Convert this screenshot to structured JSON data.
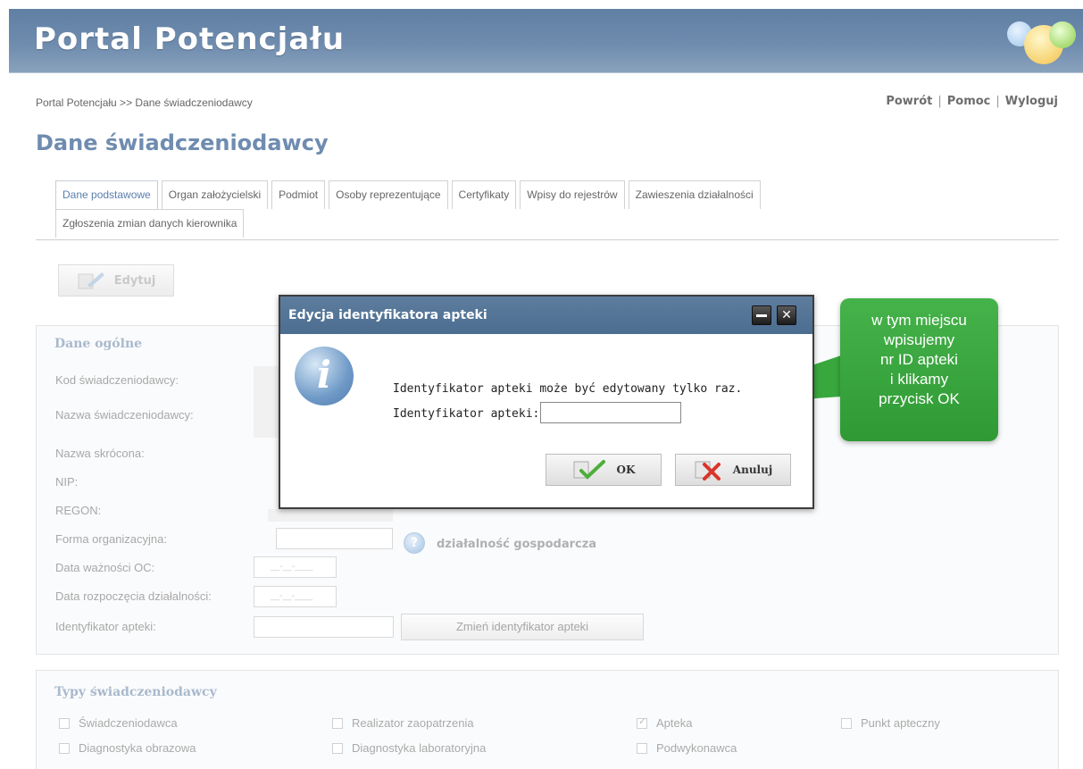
{
  "header": {
    "app_title": "Portal Potencjału"
  },
  "breadcrumb": "Portal Potencjału >> Dane świadczeniodawcy",
  "top_links": {
    "back": "Powrót",
    "help": "Pomoc",
    "logout": "Wyloguj",
    "separator": "|"
  },
  "page_title": "Dane świadczeniodawcy",
  "tabs": [
    {
      "label": "Dane podstawowe",
      "active": true
    },
    {
      "label": "Organ założycielski"
    },
    {
      "label": "Podmiot"
    },
    {
      "label": "Osoby reprezentujące"
    },
    {
      "label": "Certyfikaty"
    },
    {
      "label": "Wpisy do rejestrów"
    },
    {
      "label": "Zawieszenia działalności"
    },
    {
      "label": "Zgłoszenia zmian danych kierownika"
    }
  ],
  "toolbar": {
    "edit_label": "Edytuj"
  },
  "general": {
    "title": "Dane ogólne",
    "labels": {
      "provider_code": "Kod świadczeniodawcy:",
      "provider_name": "Nazwa świadczeniodawcy:",
      "short_name": "Nazwa skrócona:",
      "nip": "NIP:",
      "regon": "REGON:",
      "org_form": "Forma organizacyjna:",
      "oc_validity": "Data ważności OC:",
      "activity_start": "Data rozpoczęcia działalności:",
      "pharmacy_id": "Identyfikator apteki:"
    },
    "org_form_value": "działalność gospodarcza",
    "date_placeholder": "__-__-____",
    "change_id_button": "Zmień identyfikator apteki"
  },
  "types": {
    "title": "Typy świadczeniodawcy",
    "items": [
      {
        "label": "Świadczeniodawca",
        "checked": false
      },
      {
        "label": "Realizator zaopatrzenia",
        "checked": false
      },
      {
        "label": "Apteka",
        "checked": true
      },
      {
        "label": "Punkt apteczny",
        "checked": false
      },
      {
        "label": "Diagnostyka obrazowa",
        "checked": false
      },
      {
        "label": "Diagnostyka laboratoryjna",
        "checked": false
      },
      {
        "label": "Podwykonawca",
        "checked": false
      }
    ]
  },
  "dialog": {
    "title": "Edycja identyfikatora apteki",
    "message": "Identyfikator apteki może być edytowany tylko raz.",
    "field_label": "Identyfikator apteki:",
    "field_value": "",
    "ok_label": "OK",
    "cancel_label": "Anuluj"
  },
  "callout": {
    "lines": [
      "w tym miejscu",
      "wpisujemy",
      "nr ID apteki",
      "i klikamy",
      "przycisk OK"
    ]
  },
  "colors": {
    "header_blue": "#6f8cae",
    "title_blue": "#6f8cb0",
    "dialog_header": "#4b6d90",
    "callout_green": "#3aa63f"
  },
  "icons": [
    "edit-pencil-icon",
    "help-icon",
    "info-icon",
    "minimize-icon",
    "close-icon",
    "check-icon",
    "cancel-x-icon"
  ]
}
